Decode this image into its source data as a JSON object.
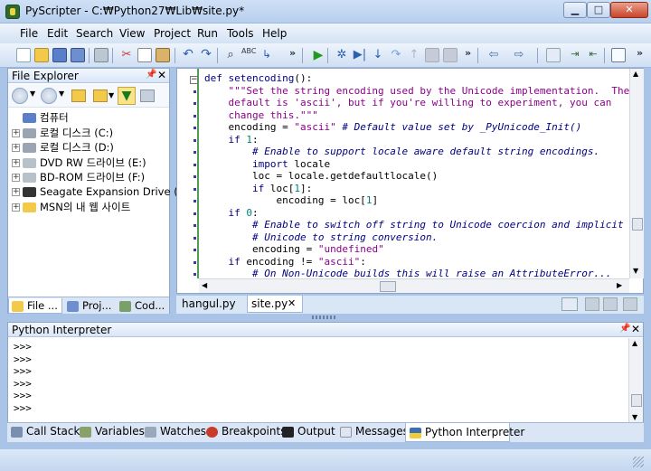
{
  "window": {
    "title": "PyScripter - C:₩Python27₩Lib₩site.py*"
  },
  "menu": [
    "File",
    "Edit",
    "Search",
    "View",
    "Project",
    "Run",
    "Tools",
    "Help"
  ],
  "file_explorer": {
    "title": "File Explorer",
    "tree": [
      {
        "label": "컴퓨터",
        "expander": "",
        "icon": "computer-icon"
      },
      {
        "label": "로컬 디스크 (C:)",
        "expander": "+",
        "icon": "hard-disk-icon"
      },
      {
        "label": "로컬 디스크 (D:)",
        "expander": "+",
        "icon": "hard-disk-icon"
      },
      {
        "label": "DVD RW 드라이브 (E:)",
        "expander": "+",
        "icon": "dvd-drive-icon"
      },
      {
        "label": "BD-ROM 드라이브 (F:)",
        "expander": "+",
        "icon": "dvd-drive-icon"
      },
      {
        "label": "Seagate Expansion Drive (G:)",
        "expander": "+",
        "icon": "external-drive-icon"
      },
      {
        "label": "MSN의 내 웹 사이트",
        "expander": "+",
        "icon": "folder-icon"
      }
    ],
    "tabs": [
      "File ...",
      "Proj...",
      "Cod..."
    ]
  },
  "editor": {
    "lines": [
      [
        [
          "kw",
          "def "
        ],
        [
          "fn",
          "setencoding"
        ],
        [
          "",
          "():"
        ]
      ],
      [
        [
          "str",
          "    \"\"\"Set the string encoding used by the Unicode implementation.  The"
        ]
      ],
      [
        [
          "str",
          "    default is 'ascii', but if you're willing to experiment, you can"
        ]
      ],
      [
        [
          "str",
          "    change this.\"\"\""
        ]
      ],
      [
        [
          "",
          "    encoding = "
        ],
        [
          "str",
          "\"ascii\""
        ],
        [
          "cm",
          " # Default value set by _PyUnicode_Init()"
        ]
      ],
      [
        [
          "kw",
          "    if "
        ],
        [
          "num",
          "1"
        ],
        [
          "",
          ":"
        ]
      ],
      [
        [
          "cm",
          "        # Enable to support locale aware default string encodings."
        ]
      ],
      [
        [
          "kw",
          "        import "
        ],
        [
          "",
          "locale"
        ]
      ],
      [
        [
          "",
          "        loc = locale.getdefaultlocale()"
        ]
      ],
      [
        [
          "kw",
          "        if "
        ],
        [
          "",
          "loc["
        ],
        [
          "num",
          "1"
        ],
        [
          "",
          "]:"
        ]
      ],
      [
        [
          "",
          "            encoding = loc["
        ],
        [
          "num",
          "1"
        ],
        [
          "",
          "]"
        ]
      ],
      [
        [
          "kw",
          "    if "
        ],
        [
          "num",
          "0"
        ],
        [
          "",
          ":"
        ]
      ],
      [
        [
          "cm",
          "        # Enable to switch off string to Unicode coercion and implicit"
        ]
      ],
      [
        [
          "cm",
          "        # Unicode to string conversion."
        ]
      ],
      [
        [
          "",
          "        encoding = "
        ],
        [
          "str",
          "\"undefined\""
        ]
      ],
      [
        [
          "kw",
          "    if "
        ],
        [
          "",
          "encoding != "
        ],
        [
          "str",
          "\"ascii\""
        ],
        [
          "",
          ":"
        ]
      ],
      [
        [
          "cm",
          "        # On Non-Unicode builds this will raise an AttributeError..."
        ]
      ]
    ],
    "tabs": [
      "hangul.py",
      "site.py"
    ],
    "close_glyph": "✕"
  },
  "python_interpreter": {
    "title": "Python Interpreter",
    "lines": [
      ">>>",
      ">>>",
      ">>>",
      ">>>",
      ">>>",
      ">>>"
    ]
  },
  "bottom_tabs": [
    "Call Stack",
    "Variables",
    "Watches",
    "Breakpoints",
    "Output",
    "Messages",
    "Python Interpreter"
  ],
  "colors": {
    "accent": "#4ea04e",
    "keyword": "#000080",
    "string": "#8b008b",
    "number": "#008080"
  }
}
